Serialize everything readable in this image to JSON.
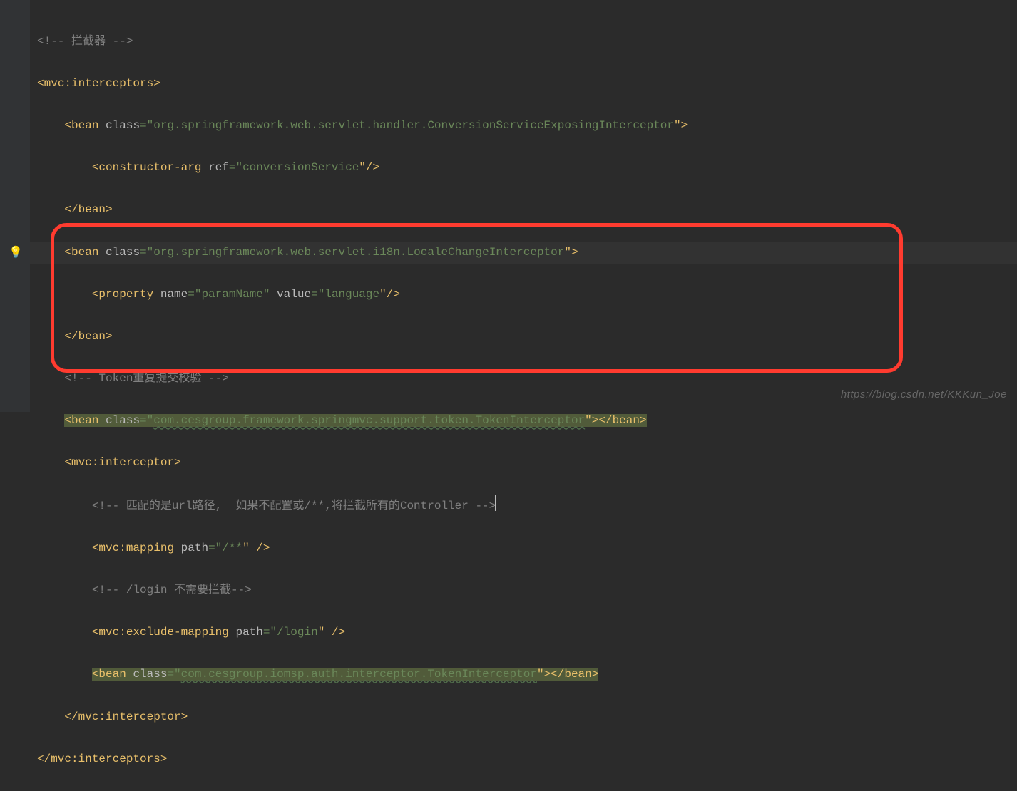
{
  "lines": {
    "l1": "<!-- 拦截器 -->",
    "l2_open": "<",
    "l2_tag": "mvc:interceptors",
    "l2_close": ">",
    "l3_open": "    <",
    "l3_tag": "bean",
    "l3_sp": " ",
    "l3_attr": "class",
    "l3_eq": "=\"",
    "l3_val": "org.springframework.web.servlet.handler.ConversionServiceExposingInterceptor",
    "l3_close": "\">",
    "l4_open": "        <",
    "l4_tag": "constructor-arg",
    "l4_sp": " ",
    "l4_attr": "ref",
    "l4_eq": "=\"",
    "l4_val": "conversionService",
    "l4_close": "\"/>",
    "l5_open": "    </",
    "l5_tag": "bean",
    "l5_close": ">",
    "l6_open": "    <",
    "l6_tag": "bean",
    "l6_sp": " ",
    "l6_attr": "class",
    "l6_eq": "=\"",
    "l6_val": "org.springframework.web.servlet.i18n.LocaleChangeInterceptor",
    "l6_close": "\">",
    "l7_open": "        <",
    "l7_tag": "property",
    "l7_sp": " ",
    "l7_attr1": "name",
    "l7_eq1": "=\"",
    "l7_val1": "paramName",
    "l7_mid": "\" ",
    "l7_attr2": "value",
    "l7_eq2": "=\"",
    "l7_val2": "language",
    "l7_close": "\"/>",
    "l8_open": "    </",
    "l8_tag": "bean",
    "l8_close": ">",
    "l9": "    <!-- Token重复提交校验 -->",
    "l10_open": "    <",
    "l10_tag": "bean",
    "l10_sp": " ",
    "l10_attr": "class",
    "l10_eq": "=\"",
    "l10_val": "com.cesgroup.framework.springmvc.support.token.TokenInterceptor",
    "l10_mid": "\">",
    "l10_c1": "</",
    "l10_c2": "bean",
    "l10_c3": ">",
    "l11_open": "    <",
    "l11_tag": "mvc:interceptor",
    "l11_close": ">",
    "l12": "        <!-- 匹配的是url路径,  如果不配置或/**,将拦截所有的Controller -->",
    "l13_open": "        <",
    "l13_tag": "mvc:mapping",
    "l13_sp": " ",
    "l13_attr": "path",
    "l13_eq": "=\"",
    "l13_val": "/**",
    "l13_close": "\" />",
    "l14": "        <!-- /login 不需要拦截-->",
    "l15_open": "        <",
    "l15_tag": "mvc:exclude-mapping",
    "l15_sp": " ",
    "l15_attr": "path",
    "l15_eq": "=\"",
    "l15_val": "/login",
    "l15_close": "\" />",
    "l16_open": "        <",
    "l16_tag": "bean",
    "l16_sp": " ",
    "l16_attr": "class",
    "l16_eq": "=\"",
    "l16_val": "com.cesgroup.iomsp.auth.interceptor.TokenInterceptor",
    "l16_mid": "\">",
    "l16_c1": "</",
    "l16_c2": "bean",
    "l16_c3": ">",
    "l17_open": "    </",
    "l17_tag": "mvc:interceptor",
    "l17_close": ">",
    "l18_open": "</",
    "l18_tag": "mvc:interceptors",
    "l18_close": ">"
  },
  "watermark": "https://blog.csdn.net/KKKun_Joe",
  "bulb": "💡"
}
